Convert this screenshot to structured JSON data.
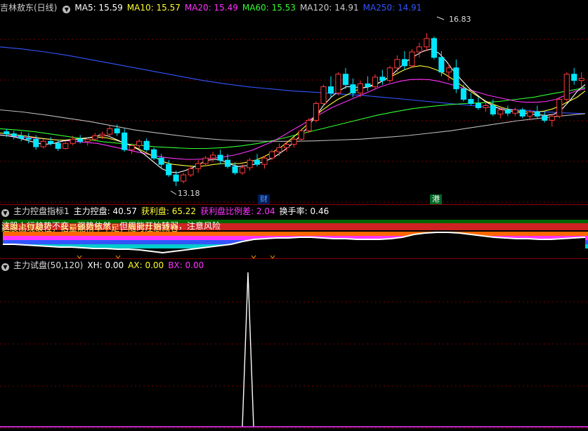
{
  "top_header": {
    "title": "吉林敖东(日线)",
    "ma5": "MA5: 15.59",
    "ma10": "MA10: 15.57",
    "ma20": "MA20: 15.49",
    "ma60": "MA60: 15.53",
    "ma120": "MA120: 14.91",
    "ma250": "MA250: 14.91"
  },
  "colors": {
    "up": "#ff3b3b",
    "down": "#00e6ff",
    "ma5": "#ffffff",
    "ma10": "#ffff33",
    "ma20": "#ff33ff",
    "ma60": "#33ff33",
    "ma120": "#bbbbbb",
    "ma250": "#3355ff"
  },
  "annotations": {
    "high": "16.83",
    "low": "13.18",
    "marker1": "财",
    "marker2": "港"
  },
  "mid_header": {
    "title": "主力控盘指标1",
    "control": "主力控盘: 40.57",
    "profit": "获利盘: 65.22",
    "profit_diff": "获利盘比例差: 2.04",
    "turnover": "换手率: 0.46"
  },
  "messages": {
    "line1": "这股上行趋势不变，强势依然，但周能开始转弱，注意风险",
    "line2": "这股出现破位，估量能精华不足，随时注意减仓"
  },
  "bottom_header": {
    "title": "主力试盘(50,120)",
    "xh": "XH: 0.00",
    "ax": "AX: 0.00",
    "bx": "BX: 0.00"
  },
  "chart_data": {
    "type": "candlestick",
    "ylim": [
      12.9,
      17.25
    ],
    "candles": [
      [
        14.48,
        14.55,
        14.35,
        14.43
      ],
      [
        14.43,
        14.5,
        14.3,
        14.38
      ],
      [
        14.38,
        14.48,
        14.25,
        14.32
      ],
      [
        14.32,
        14.45,
        14.2,
        14.3
      ],
      [
        14.3,
        14.4,
        14.05,
        14.12
      ],
      [
        14.12,
        14.3,
        14.08,
        14.25
      ],
      [
        14.25,
        14.35,
        14.15,
        14.2
      ],
      [
        14.2,
        14.28,
        14.02,
        14.08
      ],
      [
        14.08,
        14.25,
        14.05,
        14.2
      ],
      [
        14.2,
        14.38,
        14.15,
        14.3
      ],
      [
        14.3,
        14.4,
        14.2,
        14.25
      ],
      [
        14.25,
        14.35,
        14.15,
        14.3
      ],
      [
        14.3,
        14.45,
        14.25,
        14.38
      ],
      [
        14.38,
        14.48,
        14.3,
        14.42
      ],
      [
        14.42,
        14.62,
        14.35,
        14.55
      ],
      [
        14.55,
        14.65,
        14.38,
        14.45
      ],
      [
        14.45,
        14.55,
        14.0,
        14.05
      ],
      [
        14.05,
        14.2,
        13.95,
        14.15
      ],
      [
        14.15,
        14.3,
        14.05,
        14.25
      ],
      [
        14.25,
        14.32,
        14.0,
        14.05
      ],
      [
        14.05,
        14.1,
        13.8,
        13.85
      ],
      [
        13.85,
        13.95,
        13.6,
        13.7
      ],
      [
        13.7,
        13.8,
        13.4,
        13.45
      ],
      [
        13.45,
        13.55,
        13.18,
        13.3
      ],
      [
        13.3,
        13.5,
        13.25,
        13.45
      ],
      [
        13.45,
        13.65,
        13.4,
        13.6
      ],
      [
        13.6,
        13.8,
        13.5,
        13.72
      ],
      [
        13.72,
        13.9,
        13.65,
        13.85
      ],
      [
        13.85,
        14.0,
        13.75,
        13.92
      ],
      [
        13.92,
        14.05,
        13.7,
        13.8
      ],
      [
        13.8,
        13.95,
        13.6,
        13.65
      ],
      [
        13.65,
        13.75,
        13.45,
        13.5
      ],
      [
        13.5,
        13.7,
        13.45,
        13.62
      ],
      [
        13.62,
        13.85,
        13.55,
        13.8
      ],
      [
        13.8,
        13.95,
        13.65,
        13.7
      ],
      [
        13.7,
        13.9,
        13.6,
        13.85
      ],
      [
        13.85,
        14.05,
        13.8,
        14.0
      ],
      [
        14.0,
        14.2,
        13.9,
        14.1
      ],
      [
        14.1,
        14.25,
        14.0,
        14.18
      ],
      [
        14.18,
        14.35,
        14.1,
        14.3
      ],
      [
        14.3,
        14.55,
        14.25,
        14.5
      ],
      [
        14.5,
        14.8,
        14.45,
        14.75
      ],
      [
        14.75,
        15.2,
        14.7,
        15.15
      ],
      [
        15.15,
        15.6,
        15.1,
        15.55
      ],
      [
        15.55,
        15.8,
        15.3,
        15.4
      ],
      [
        15.4,
        15.9,
        15.35,
        15.85
      ],
      [
        15.85,
        16.0,
        15.5,
        15.6
      ],
      [
        15.6,
        15.75,
        15.3,
        15.4
      ],
      [
        15.4,
        15.7,
        15.3,
        15.62
      ],
      [
        15.62,
        15.8,
        15.45,
        15.55
      ],
      [
        15.55,
        15.85,
        15.5,
        15.78
      ],
      [
        15.78,
        15.95,
        15.6,
        15.7
      ],
      [
        15.7,
        16.05,
        15.65,
        16.0
      ],
      [
        16.0,
        16.3,
        15.9,
        16.2
      ],
      [
        16.2,
        16.4,
        15.95,
        16.05
      ],
      [
        16.05,
        16.45,
        16.0,
        16.38
      ],
      [
        16.38,
        16.6,
        16.25,
        16.5
      ],
      [
        16.5,
        16.83,
        16.4,
        16.7
      ],
      [
        16.7,
        16.75,
        16.2,
        16.25
      ],
      [
        16.25,
        16.4,
        15.8,
        15.9
      ],
      [
        15.9,
        16.1,
        15.7,
        16.0
      ],
      [
        16.0,
        16.2,
        15.4,
        15.5
      ],
      [
        15.5,
        15.6,
        15.2,
        15.25
      ],
      [
        15.25,
        15.4,
        15.1,
        15.15
      ],
      [
        15.15,
        15.3,
        15.0,
        15.05
      ],
      [
        15.05,
        15.2,
        14.95,
        15.1
      ],
      [
        15.1,
        15.25,
        14.85,
        14.9
      ],
      [
        14.9,
        15.05,
        14.8,
        15.0
      ],
      [
        15.0,
        15.1,
        14.85,
        14.92
      ],
      [
        14.92,
        15.05,
        14.85,
        15.0
      ],
      [
        15.0,
        15.05,
        14.8,
        14.85
      ],
      [
        14.85,
        15.0,
        14.75,
        14.95
      ],
      [
        14.95,
        15.1,
        14.8,
        14.85
      ],
      [
        14.85,
        14.95,
        14.7,
        14.75
      ],
      [
        14.75,
        14.9,
        14.6,
        14.85
      ],
      [
        14.85,
        15.3,
        14.8,
        15.25
      ],
      [
        15.25,
        15.9,
        15.2,
        15.85
      ],
      [
        15.85,
        16.0,
        15.6,
        15.7
      ],
      [
        15.7,
        15.9,
        15.55,
        15.75
      ]
    ],
    "ma": {
      "ma5": [
        14.4,
        14.38,
        14.35,
        14.3,
        14.25,
        14.2,
        14.18,
        14.2,
        14.25,
        14.28,
        14.3,
        14.32,
        14.35,
        14.4,
        14.38,
        14.3,
        14.22,
        14.15,
        14.05,
        13.9,
        13.75,
        13.6,
        13.52,
        13.5,
        13.55,
        13.62,
        13.72,
        13.8,
        13.82,
        13.78,
        13.7,
        13.65,
        13.67,
        13.7,
        13.75,
        13.82,
        13.92,
        14.05,
        14.2,
        14.38,
        14.6,
        14.85,
        15.1,
        15.3,
        15.45,
        15.55,
        15.55,
        15.52,
        15.55,
        15.62,
        15.72,
        15.85,
        16.02,
        16.18,
        16.3,
        16.4,
        16.45,
        16.35,
        16.15,
        15.9,
        15.7,
        15.5,
        15.35,
        15.2,
        15.1,
        15.02,
        14.98,
        14.95,
        14.92,
        14.9,
        14.88,
        14.87,
        14.9,
        15.02,
        15.22,
        15.45,
        15.6
      ],
      "ma10": [
        14.45,
        14.42,
        14.4,
        14.38,
        14.35,
        14.32,
        14.3,
        14.28,
        14.28,
        14.3,
        14.32,
        14.34,
        14.35,
        14.33,
        14.28,
        14.22,
        14.15,
        14.05,
        13.95,
        13.85,
        13.75,
        13.7,
        13.68,
        13.66,
        13.65,
        13.67,
        13.7,
        13.72,
        13.72,
        13.72,
        13.75,
        13.8,
        13.88,
        13.98,
        14.1,
        14.25,
        14.42,
        14.6,
        14.8,
        14.98,
        15.12,
        15.25,
        15.35,
        15.45,
        15.52,
        15.58,
        15.65,
        15.75,
        15.85,
        15.95,
        16.02,
        16.05,
        16.02,
        15.95,
        15.85,
        15.72,
        15.58,
        15.45,
        15.32,
        15.2,
        15.12,
        15.05,
        15.0,
        14.97,
        14.95,
        14.95,
        14.97,
        15.02,
        15.1,
        15.2,
        15.3,
        15.45
      ],
      "ma20": [
        14.4,
        14.38,
        14.36,
        14.34,
        14.32,
        14.3,
        14.28,
        14.26,
        14.24,
        14.22,
        14.2,
        14.15,
        14.1,
        14.05,
        14.0,
        13.95,
        13.9,
        13.86,
        13.84,
        13.82,
        13.82,
        13.83,
        13.85,
        13.88,
        13.92,
        13.98,
        14.05,
        14.15,
        14.25,
        14.38,
        14.52,
        14.65,
        14.8,
        14.92,
        15.05,
        15.15,
        15.25,
        15.35,
        15.45,
        15.55,
        15.62,
        15.68,
        15.72,
        15.73,
        15.72,
        15.68,
        15.62,
        15.55,
        15.48,
        15.42,
        15.35,
        15.3,
        15.25,
        15.2,
        15.18,
        15.18,
        15.2,
        15.25,
        15.35,
        15.45,
        15.5
      ],
      "ma60": [
        14.55,
        14.52,
        14.48,
        14.42,
        14.36,
        14.3,
        14.24,
        14.2,
        14.16,
        14.12,
        14.1,
        14.08,
        14.08,
        14.1,
        14.14,
        14.2,
        14.28,
        14.38,
        14.48,
        14.58,
        14.68,
        14.78,
        14.88,
        14.96,
        15.03,
        15.08,
        15.12,
        15.15,
        15.17,
        15.2,
        15.25,
        15.3,
        15.38,
        15.45,
        15.53
      ],
      "ma120": [
        15.0,
        14.95,
        14.88,
        14.8,
        14.72,
        14.62,
        14.52,
        14.45,
        14.38,
        14.32,
        14.28,
        14.26,
        14.25,
        14.25,
        14.26,
        14.28,
        14.3,
        14.34,
        14.38,
        14.44,
        14.5,
        14.58,
        14.66,
        14.74,
        14.8,
        14.86,
        14.91
      ],
      "ma250": [
        16.5,
        16.45,
        16.38,
        16.3,
        16.2,
        16.1,
        16.0,
        15.9,
        15.8,
        15.7,
        15.62,
        15.55,
        15.5,
        15.45,
        15.42,
        15.38,
        15.35,
        15.3,
        15.25,
        15.2,
        15.15,
        15.1,
        15.05,
        15.0,
        14.96,
        14.93,
        14.91
      ]
    },
    "indicator": [
      48,
      48,
      47,
      46,
      45,
      44,
      44,
      43,
      42,
      42,
      41,
      41,
      40,
      38,
      36,
      38,
      40,
      42,
      44,
      46,
      48,
      52,
      55,
      56,
      57,
      57,
      58,
      58,
      57,
      56,
      56,
      55,
      55,
      55,
      56,
      58,
      62,
      64,
      65,
      65,
      64,
      62,
      60,
      58,
      57,
      56,
      56,
      55,
      55,
      56,
      57,
      58
    ],
    "trial_spike": {
      "x_index": 35,
      "value": 1.0
    }
  }
}
